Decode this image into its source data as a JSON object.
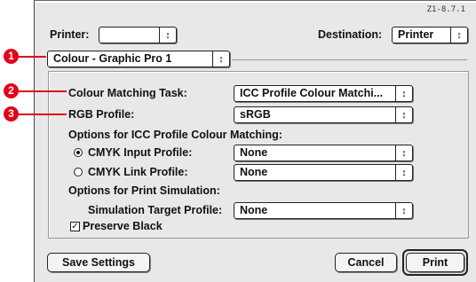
{
  "version": "Z1-8.7.1",
  "header": {
    "printer_label": "Printer:",
    "printer_value": "",
    "destination_label": "Destination:",
    "destination_value": "Printer"
  },
  "panel_popup": "Colour - Graphic Pro 1",
  "settings": {
    "task_label": "Colour Matching Task:",
    "task_value": "ICC Profile Colour Matchi...",
    "rgb_label": "RGB Profile:",
    "rgb_value": "sRGB",
    "icc_section": "Options for ICC Profile Colour Matching:",
    "cmyk_input_label": "CMYK Input Profile:",
    "cmyk_input_value": "None",
    "cmyk_input_selected": true,
    "cmyk_link_label": "CMYK Link Profile:",
    "cmyk_link_value": "None",
    "cmyk_link_selected": false,
    "sim_section": "Options for Print Simulation:",
    "sim_target_label": "Simulation Target Profile:",
    "sim_target_value": "None",
    "preserve_black_label": "Preserve Black",
    "preserve_black_checked": true
  },
  "buttons": {
    "save": "Save Settings",
    "cancel": "Cancel",
    "print": "Print"
  },
  "callouts": [
    "1",
    "2",
    "3"
  ],
  "colors": {
    "callout": "#e2001a",
    "dialog_bg": "#e8e8e8"
  },
  "icons": {
    "popup_arrows": "up-down-arrows-icon",
    "check": "checkmark-icon"
  }
}
